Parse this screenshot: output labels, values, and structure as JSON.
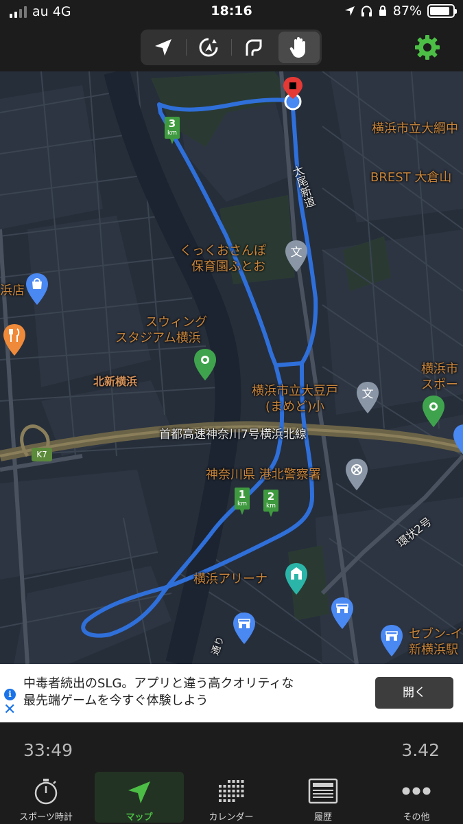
{
  "status": {
    "carrier": "au 4G",
    "time": "18:16",
    "battery": "87%",
    "battery_level": 0.87
  },
  "toolbar": {
    "modes": [
      {
        "icon": "navigation-arrow-icon"
      },
      {
        "icon": "auto-rotate-icon"
      },
      {
        "icon": "route-draw-icon"
      },
      {
        "icon": "hand-pan-icon",
        "selected": true
      }
    ],
    "settings_icon": "gear-icon",
    "accent": "#4cbe46"
  },
  "map": {
    "labels": {
      "okura_school": "横浜市立大綱中",
      "brest": "BREST 大倉山",
      "taio_road": "太尾新道",
      "kukkuo_1": "くっくおさんぽ",
      "kukkuo_2": "保育園ふとお",
      "ten": "浜店",
      "swing_1": "スウィング",
      "swing_2": "スタジアム横浜",
      "kitashin": "北新横浜",
      "mamedo_1": "横浜市立大豆戸",
      "mamedo_2": "(まめど)小",
      "yokohama_sport_1": "横浜市",
      "yokohama_sport_2": "スポー",
      "expressway": "首都高速神奈川7号横浜北線",
      "k7": "K7",
      "police": "神奈川県 港北警察署",
      "arena": "横浜アリーナ",
      "ring2": "環状2号",
      "seven_1": "セブン-イ",
      "seven_2": "新横浜駅",
      "street": "通り"
    },
    "km_markers": [
      "1",
      "2",
      "3"
    ],
    "km_unit": "km",
    "route_color": "#2f6fd9"
  },
  "ad": {
    "line1": "中毒者続出のSLG。アプリと違う高クオリティな",
    "line2": "最先端ゲームを今すぐ体験しよう",
    "open_label": "開く",
    "info_icon": "i",
    "close_icon": "✕"
  },
  "stats": {
    "elapsed": "33:49",
    "distance": "3.42"
  },
  "tabs": [
    {
      "label": "スポーツ時計",
      "icon": "stopwatch-icon"
    },
    {
      "label": "マップ",
      "icon": "map-arrow-icon",
      "selected": true
    },
    {
      "label": "カレンダー",
      "icon": "calendar-grid-icon"
    },
    {
      "label": "履歴",
      "icon": "history-list-icon"
    },
    {
      "label": "その他",
      "icon": "more-dots-icon"
    }
  ]
}
